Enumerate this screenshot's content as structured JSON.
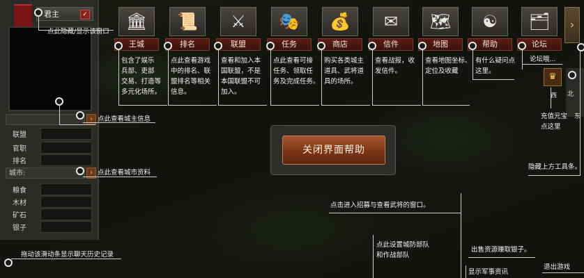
{
  "left_panel": {
    "lord_tab": "君主",
    "fields": [
      {
        "label": "联盟"
      },
      {
        "label": "官职"
      },
      {
        "label": "排名"
      }
    ],
    "city_select": "城市:",
    "resources": [
      {
        "label": "粮食"
      },
      {
        "label": "木材"
      },
      {
        "label": "矿石"
      },
      {
        "label": "银子"
      }
    ]
  },
  "toolbar": {
    "items": [
      {
        "label": "王城",
        "icon": "sphinx-statue-icon",
        "glyph": "🏛"
      },
      {
        "label": "排名",
        "icon": "scroll-icon",
        "glyph": "📜"
      },
      {
        "label": "联盟",
        "icon": "crossed-swords-icon",
        "glyph": "⚔"
      },
      {
        "label": "任务",
        "icon": "mask-icon",
        "glyph": "🎭"
      },
      {
        "label": "商店",
        "icon": "gold-ingot-icon",
        "glyph": "💰"
      },
      {
        "label": "信件",
        "icon": "letter-icon",
        "glyph": "✉"
      },
      {
        "label": "地图",
        "icon": "map-icon",
        "glyph": "🗺"
      },
      {
        "label": "帮助",
        "icon": "yin-yang-icon",
        "glyph": "☯"
      },
      {
        "label": "论坛",
        "icon": "forum-icon",
        "glyph": "🗂"
      }
    ],
    "scroll_glyph": "›"
  },
  "notes": {
    "toggle_window": "点此隐藏/显示该窗口",
    "lord_info": "点此查看城主信息",
    "city_info": "点此查看城市资料",
    "chat_history": "拖动该滑动条显示聊天历史记录",
    "wangcheng": [
      "包含了娱乐",
      "兵部、吏部",
      "交易、打造等",
      "多元化场所。"
    ],
    "paiming": [
      "点此查看游戏",
      "中的排名、联",
      "盟排名等相关",
      "信息。"
    ],
    "lianmeng": [
      "查看和加入本",
      "国联盟，不是",
      "本国联盟不可",
      "加入。"
    ],
    "renwu": [
      "点此查看可接",
      "任务、领取任",
      "务及完成任务。"
    ],
    "shangdian": [
      "购买各类城主",
      "道具、武将道",
      "具的场所。"
    ],
    "xinjian": [
      "查看战报，收",
      "发信件。"
    ],
    "ditu": [
      "查看地图坐标、",
      "定位及收藏"
    ],
    "bangzhu": [
      "有什么疑问点",
      "这里。"
    ],
    "luntan": "论坛哦...",
    "yuanbao": [
      "充值元宝",
      "点这里"
    ],
    "hide_toolbar": "隐藏上方工具条。",
    "recruit": "点击进入招募与查看武将的窗口。",
    "defense": [
      "点此设置城防部队",
      "和作战部队"
    ],
    "sell": "出售资源赚取银子。",
    "military": "显示军事资讯",
    "exit": "退出游戏"
  },
  "close_button": "关闭界面帮助",
  "compass": {
    "west": "西",
    "north": "北",
    "east": "东"
  }
}
